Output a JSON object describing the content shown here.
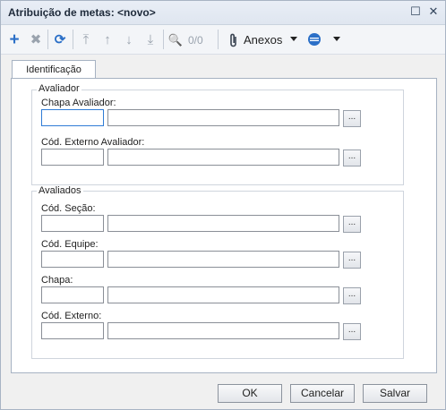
{
  "window": {
    "title": "Atribuição de metas: <novo>",
    "restore_glyph": "☐",
    "close_glyph": "✕"
  },
  "toolbar": {
    "icons": {
      "add": "+",
      "delete": "✖",
      "refresh": "⟳",
      "first": "⤒",
      "up": "↑",
      "down": "↓",
      "last": "⤓",
      "search": "🔍"
    },
    "paging": "0/0",
    "anexos_label": "Anexos",
    "colors": {
      "blue": "#2b6fc7",
      "gray": "#9aa3ae"
    }
  },
  "tab": {
    "label": "Identificação"
  },
  "avaliador": {
    "legend": "Avaliador",
    "chapa_label": "Chapa Avaliador:",
    "cod_externo_label": "Cód. Externo Avaliador:"
  },
  "avaliados": {
    "legend": "Avaliados",
    "secao_label": "Cód. Seção:",
    "equipe_label": "Cód. Equipe:",
    "chapa_label": "Chapa:",
    "cod_externo_label": "Cód. Externo:"
  },
  "lookup_glyph": "...",
  "buttons": {
    "ok": "OK",
    "cancel": "Cancelar",
    "save": "Salvar"
  }
}
